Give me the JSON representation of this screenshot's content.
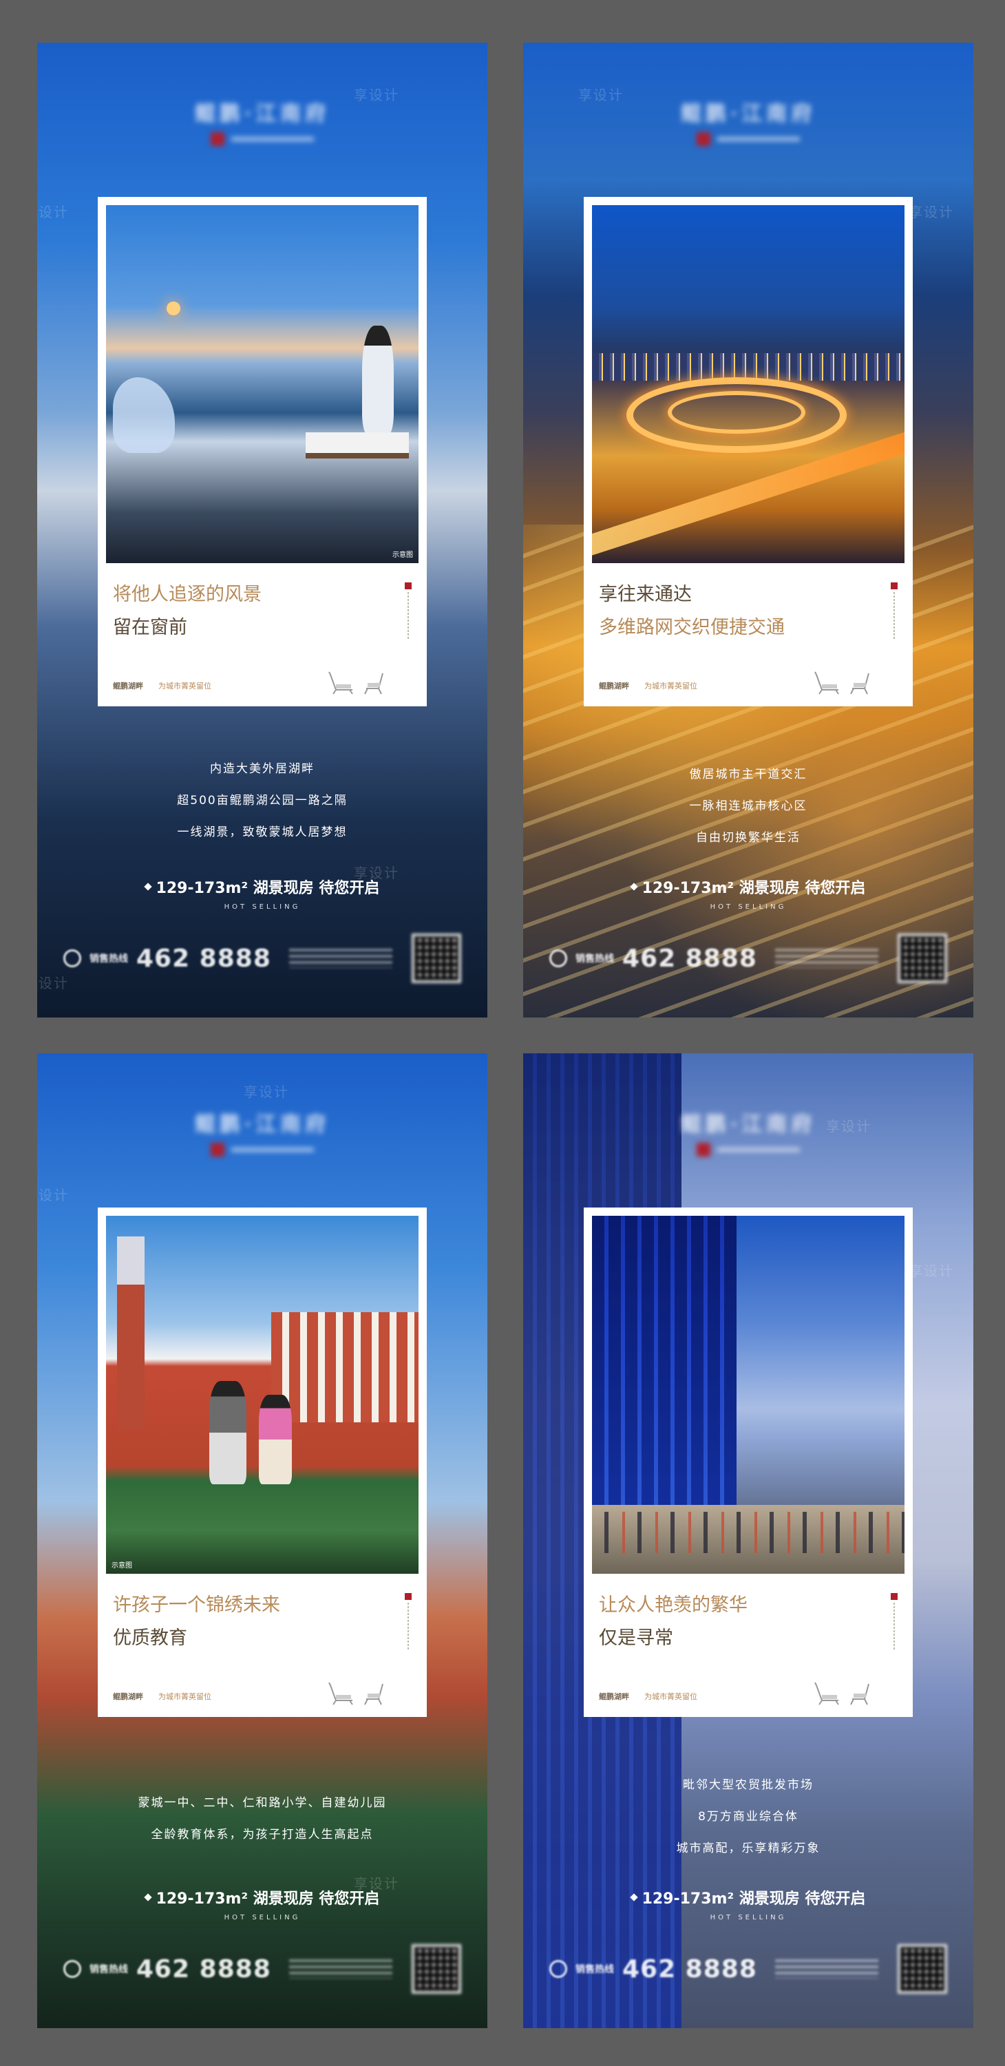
{
  "watermark": "享设计",
  "posters": [
    {
      "headline_line1": "将他人追逐的风景",
      "headline_line2": "留在窗前",
      "demo_tag": "示意图",
      "brand": "鲲鹏湖畔",
      "slogan": "为城市菁英留位",
      "body": [
        "内造大美外居湖畔",
        "超500亩鲲鹏湖公园一路之隔",
        "一线湖景，致敬蒙城人居梦想"
      ],
      "promo": "129-173m² 湖景现房  待您开启",
      "hot": "HOT SELLING",
      "phone_prefix": "销售热线",
      "phone": "462 8888"
    },
    {
      "headline_line1": "享往来通达",
      "headline_line2": "多维路网交织便捷交通",
      "demo_tag": "",
      "brand": "鲲鹏湖畔",
      "slogan": "为城市菁英留位",
      "body": [
        "傲居城市主干道交汇",
        "一脉相连城市核心区",
        "自由切换繁华生活"
      ],
      "promo": "129-173m² 湖景现房  待您开启",
      "hot": "HOT SELLING",
      "phone_prefix": "销售热线",
      "phone": "462 8888"
    },
    {
      "headline_line1": "许孩子一个锦绣未来",
      "headline_line2": "优质教育",
      "demo_tag": "示意图",
      "brand": "鲲鹏湖畔",
      "slogan": "为城市菁英留位",
      "body": [
        "蒙城一中、二中、仁和路小学、自建幼儿园",
        "全龄教育体系，为孩子打造人生高起点"
      ],
      "promo": "129-173m² 湖景现房  待您开启",
      "hot": "HOT SELLING",
      "phone_prefix": "销售热线",
      "phone": "462 8888"
    },
    {
      "headline_line1": "让众人艳羡的繁华",
      "headline_line2": "仅是寻常",
      "demo_tag": "",
      "brand": "鲲鹏湖畔",
      "slogan": "为城市菁英留位",
      "body": [
        "毗邻大型农贸批发市场",
        "8万方商业综合体",
        "城市高配，乐享精彩万象"
      ],
      "promo": "129-173m² 湖景现房  待您开启",
      "hot": "HOT SELLING",
      "phone_prefix": "销售热线",
      "phone": "462 8888"
    }
  ],
  "logo_text": "鲲鹏·江南府"
}
